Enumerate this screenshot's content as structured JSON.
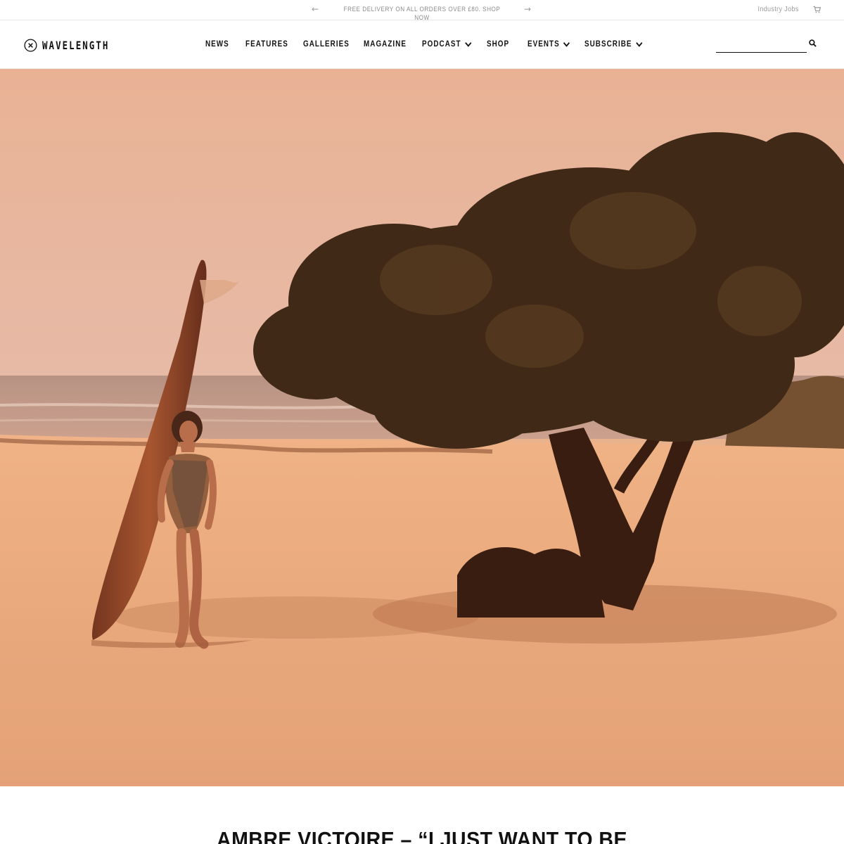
{
  "announcement": {
    "prev_arrow": "←",
    "text": "FREE DELIVERY ON ALL ORDERS OVER £80. SHOP NOW",
    "next_arrow": "→",
    "industry_jobs": "Industry Jobs",
    "cart_icon": "cart-icon"
  },
  "header": {
    "logo_text": "WAVELENGTH",
    "logo_icon": "close-circle-icon",
    "nav": [
      {
        "label": "NEWS",
        "dropdown": false
      },
      {
        "label": "FEATURES",
        "dropdown": false
      },
      {
        "label": "GALLERIES",
        "dropdown": false
      },
      {
        "label": "MAGAZINE",
        "dropdown": false
      },
      {
        "label": "PODCAST",
        "dropdown": true
      },
      {
        "label": "SHOP",
        "dropdown": false
      },
      {
        "label": "EVENTS",
        "dropdown": true
      },
      {
        "label": "SUBSCRIBE",
        "dropdown": true
      }
    ],
    "search_value": "",
    "search_icon": "search-icon"
  },
  "hero": {
    "image_subject": "hero-photo"
  },
  "article": {
    "title": "AMBRE VICTOIRE – “I JUST WANT TO BE"
  }
}
